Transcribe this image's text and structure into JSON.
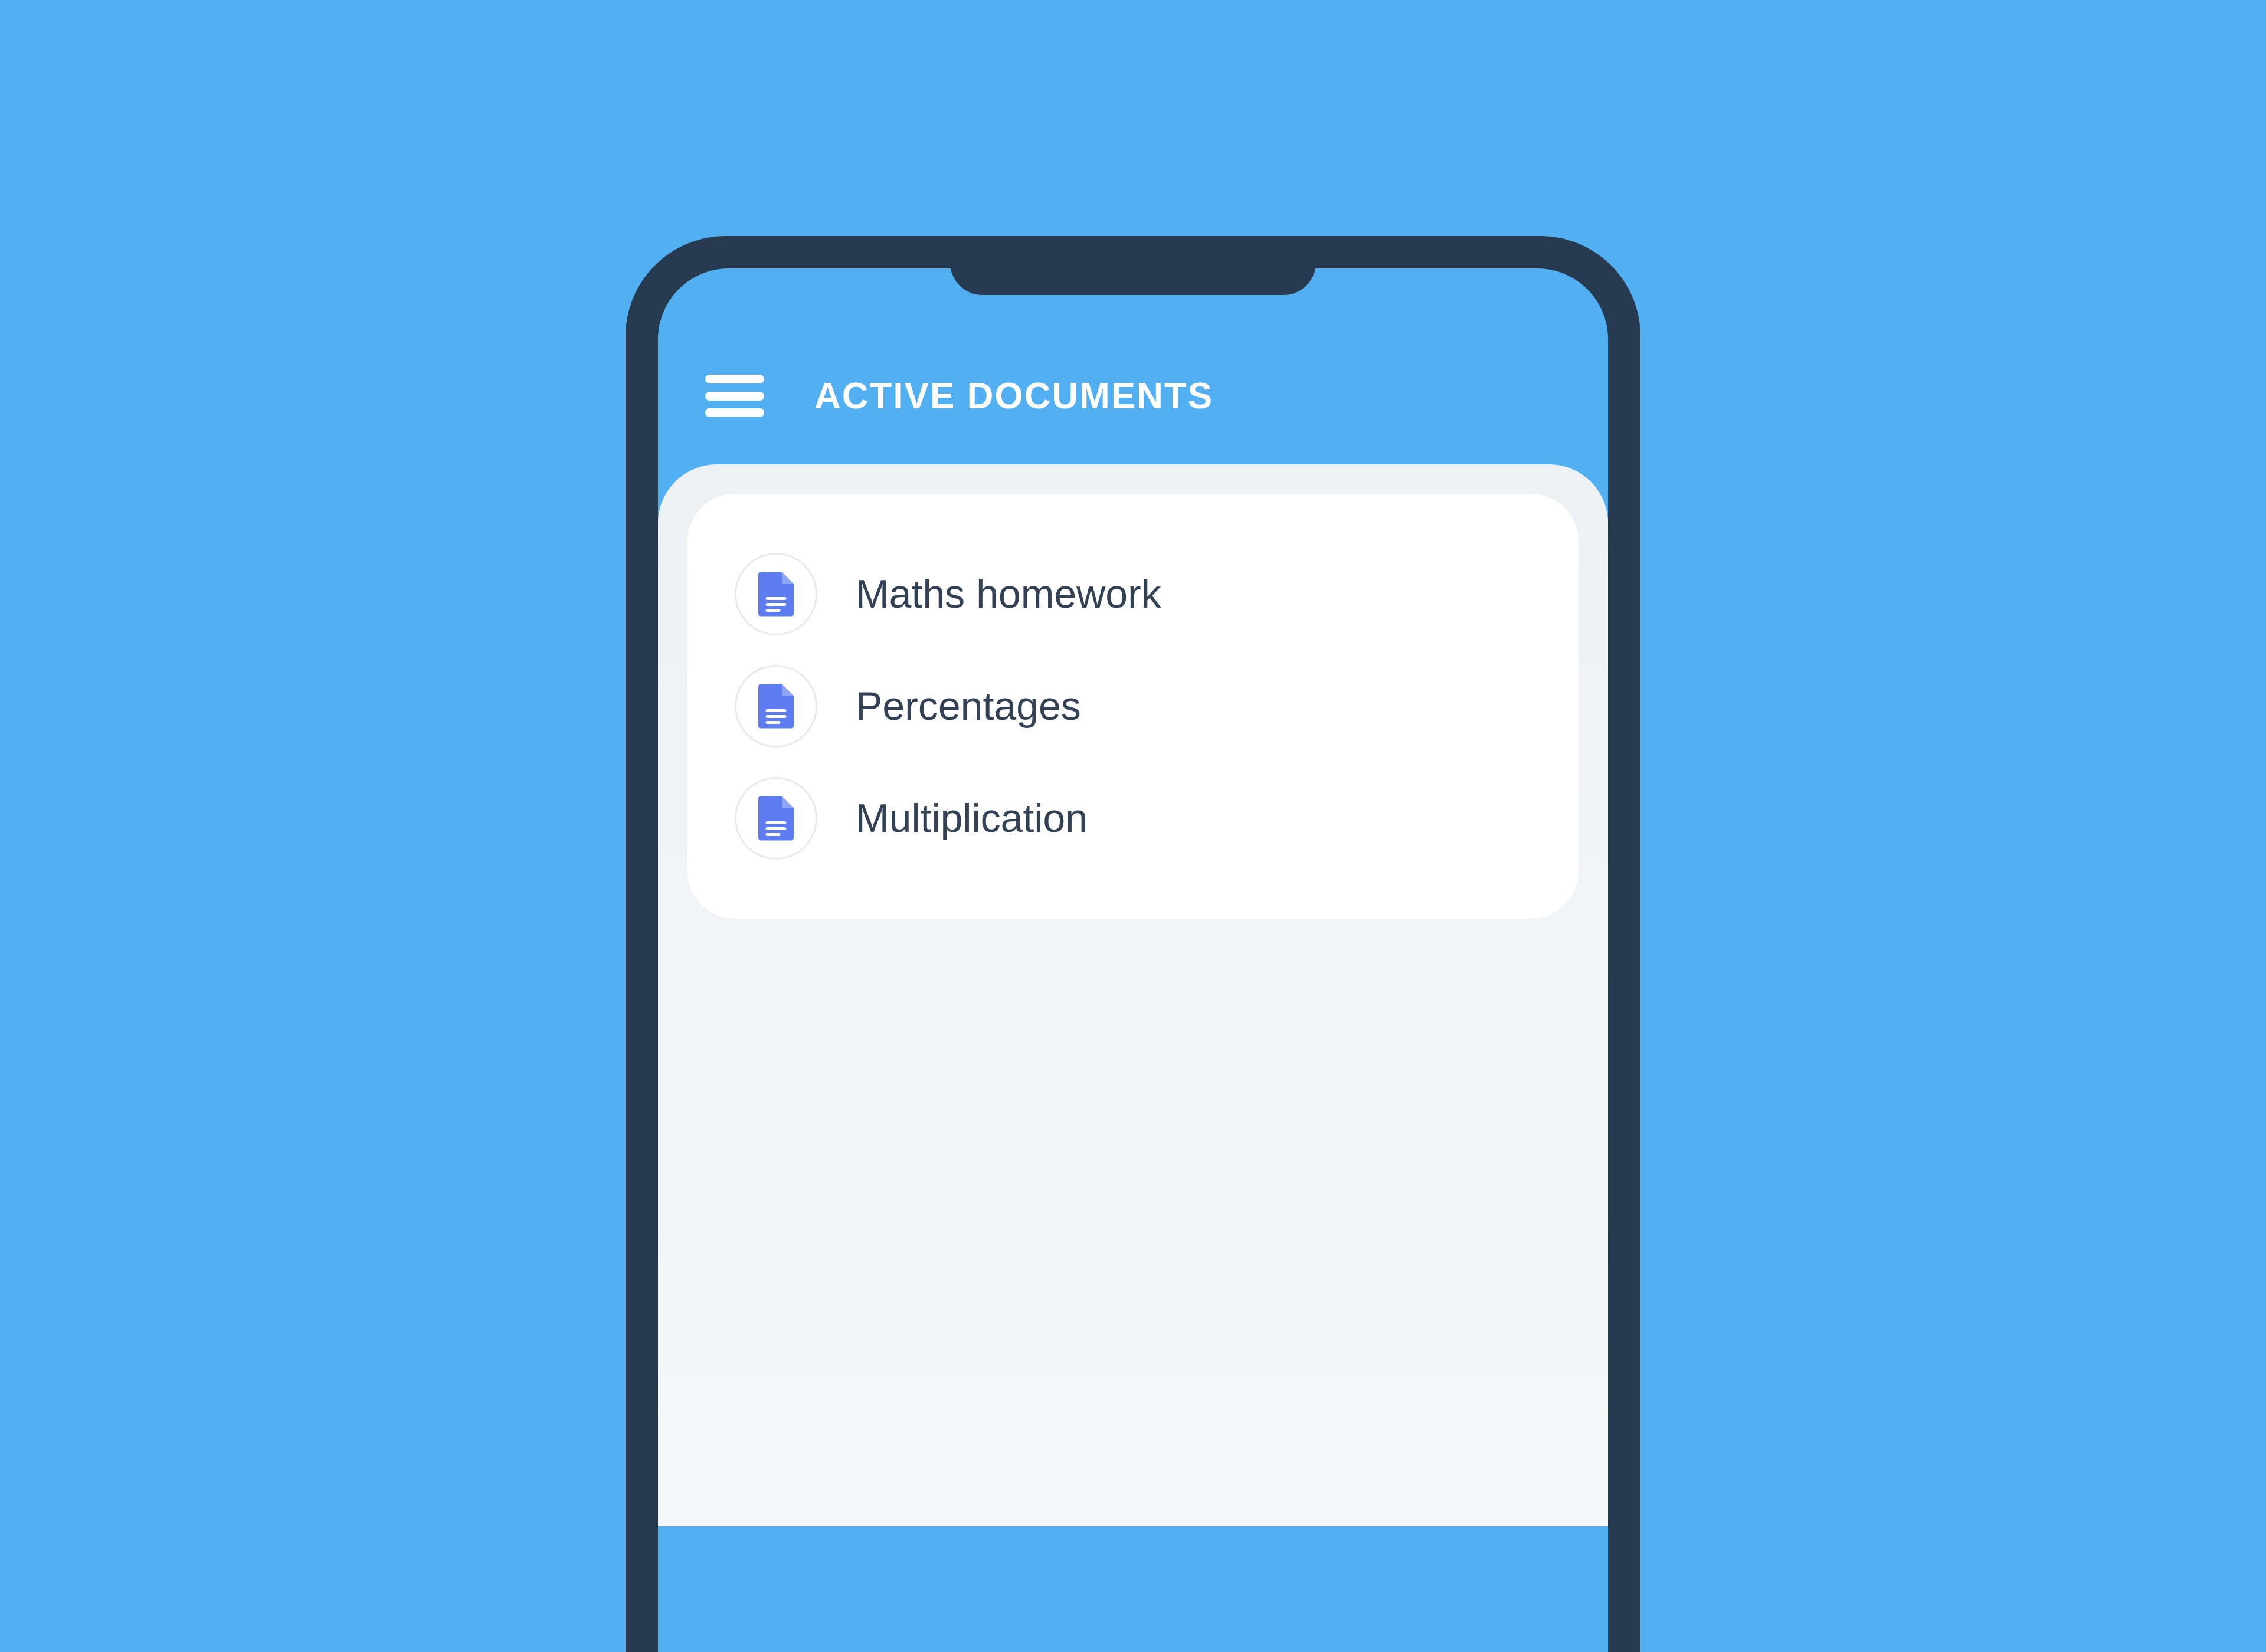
{
  "header": {
    "title": "ACTIVE DOCUMENTS"
  },
  "documents": {
    "items": [
      {
        "label": "Maths homework"
      },
      {
        "label": "Percentages"
      },
      {
        "label": "Multiplication"
      }
    ]
  },
  "colors": {
    "background": "#52b0f2",
    "frame": "#263b50",
    "accent": "#5d7cf2",
    "text": "#334155"
  }
}
